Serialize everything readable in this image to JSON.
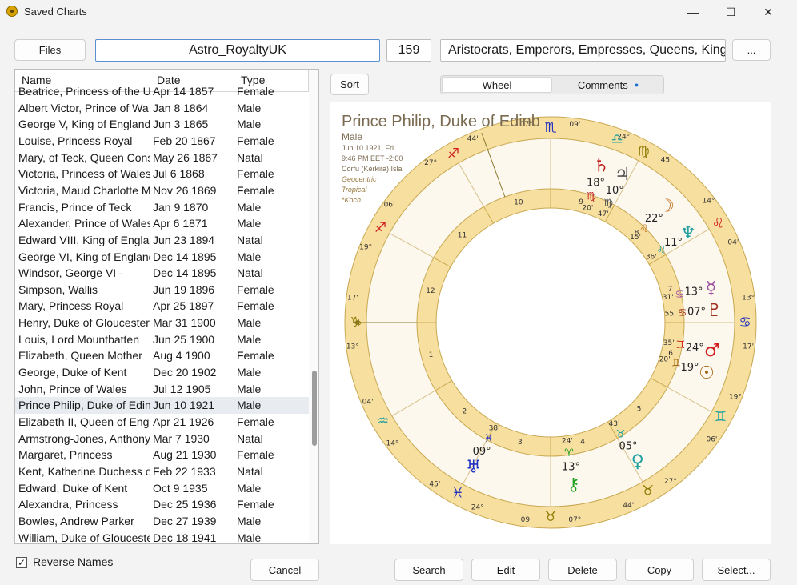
{
  "window": {
    "title": "Saved Charts",
    "minimize_glyph": "—",
    "maximize_glyph": "☐",
    "close_glyph": "✕"
  },
  "toolbar": {
    "files_label": "Files",
    "file_name": "Astro_RoyaltyUK",
    "count": "159",
    "description": "Aristocrats, Emperors, Empresses, Queens, Kings,",
    "more_label": "..."
  },
  "list": {
    "columns": [
      "Name",
      "Date",
      "Type"
    ],
    "rows": [
      [
        "Beatrice, Princess of the Ur",
        "Apr 14 1857",
        "Female"
      ],
      [
        "Albert Victor, Prince of Wa",
        "Jan 8 1864",
        "Male"
      ],
      [
        "George V, King of England",
        "Jun 3 1865",
        "Male"
      ],
      [
        "Louise, Princess Royal",
        "Feb 20 1867",
        "Female"
      ],
      [
        "Mary, of Teck, Queen Cons",
        "May 26 1867",
        "Natal"
      ],
      [
        "Victoria, Princess of Wales",
        "Jul 6 1868",
        "Female"
      ],
      [
        "Victoria, Maud Charlotte M",
        "Nov 26 1869",
        "Female"
      ],
      [
        "Francis, Prince of Teck",
        "Jan 9 1870",
        "Male"
      ],
      [
        "Alexander, Prince of Wales",
        "Apr 6 1871",
        "Male"
      ],
      [
        "Edward VIII, King of Englar",
        "Jun 23 1894",
        "Natal"
      ],
      [
        "George VI, King of England",
        "Dec 14 1895",
        "Male"
      ],
      [
        "Windsor, George VI -",
        "Dec 14 1895",
        "Natal"
      ],
      [
        "Simpson, Wallis",
        "Jun 19 1896",
        "Female"
      ],
      [
        "Mary, Princess Royal",
        "Apr 25 1897",
        "Female"
      ],
      [
        "Henry, Duke of Gloucester",
        "Mar 31 1900",
        "Male"
      ],
      [
        "Louis, Lord Mountbatten",
        "Jun 25 1900",
        "Male"
      ],
      [
        "Elizabeth, Queen Mother",
        "Aug 4 1900",
        "Female"
      ],
      [
        "George, Duke of Kent",
        "Dec 20 1902",
        "Male"
      ],
      [
        "John, Prince of Wales",
        "Jul 12 1905",
        "Male"
      ],
      [
        "Prince Philip, Duke of Edin",
        "Jun 10 1921",
        "Male"
      ],
      [
        "Elizabeth II, Queen of Engl",
        "Apr 21 1926",
        "Female"
      ],
      [
        "Armstrong-Jones, Anthony",
        "Mar 7 1930",
        "Natal"
      ],
      [
        "Margaret, Princess",
        "Aug 21 1930",
        "Female"
      ],
      [
        "Kent, Katherine Duchess o",
        "Feb 22 1933",
        "Natal"
      ],
      [
        "Edward, Duke of Kent",
        "Oct 9 1935",
        "Male"
      ],
      [
        "Alexandra, Princess",
        "Dec 25 1936",
        "Female"
      ],
      [
        "Bowles, Andrew Parker",
        "Dec 27 1939",
        "Male"
      ],
      [
        "William, Duke of Glouceste",
        "Dec 18 1941",
        "Male"
      ]
    ],
    "selected_index": 19
  },
  "sort_label": "Sort",
  "tabs": {
    "wheel": "Wheel",
    "comments": "Comments",
    "comments_dot": "●",
    "active": "Wheel"
  },
  "chart_info": {
    "name": "Prince Philip, Duke of Edinb",
    "gender": "Male",
    "date": "Jun 10 1921, Fri",
    "time": "9:46 PM EET -2:00",
    "place": "Corfu (Kérkira) Isla",
    "system": "Geocentric",
    "zodiac": "Tropical",
    "houses": "*Koch"
  },
  "wheel": {
    "house_numbers": [
      "1",
      "2",
      "3",
      "4",
      "5",
      "6",
      "7",
      "8",
      "9",
      "10",
      "11",
      "12"
    ],
    "cusp_degrees": [
      {
        "deg": "13°",
        "min": "17'",
        "sign": "♑",
        "color": "#8a7a00"
      },
      {
        "deg": "14°",
        "min": "04'",
        "sign": "♒",
        "color": "#20a0a0"
      },
      {
        "deg": "24°",
        "min": "45'",
        "sign": "♓",
        "color": "#2030c0"
      },
      {
        "deg": "07°",
        "min": "09'",
        "sign": "♉",
        "color": "#8a7a00"
      },
      {
        "deg": "27°",
        "min": "44'",
        "sign": "♉",
        "color": "#8a7a00"
      },
      {
        "deg": "19°",
        "min": "06'",
        "sign": "♊",
        "color": "#20a0a0"
      },
      {
        "deg": "13°",
        "min": "17'",
        "sign": "♋",
        "color": "#2030c0"
      },
      {
        "deg": "14°",
        "min": "04'",
        "sign": "♌",
        "color": "#d02020"
      },
      {
        "deg": "24°",
        "min": "45'",
        "sign": "♍",
        "color": "#8a7a00"
      },
      {
        "deg": "07°",
        "min": "09'",
        "sign": "♏",
        "color": "#2030c0"
      },
      {
        "deg": "27°",
        "min": "44'",
        "sign": "♐",
        "color": "#d02020"
      },
      {
        "deg": "19°",
        "min": "06'",
        "sign": "♐",
        "color": "#d02020"
      }
    ],
    "top_sign": "♎",
    "planets": [
      {
        "glyph": "♄",
        "deg": "18°",
        "sign": "♍",
        "min": "20'",
        "color": "#c02020"
      },
      {
        "glyph": "♃",
        "deg": "10°",
        "sign": "♍",
        "min": "47'",
        "color": "#555"
      },
      {
        "glyph": "☽",
        "deg": "22°",
        "sign": "♌",
        "min": "15'",
        "color": "#c07020"
      },
      {
        "glyph": "♆",
        "deg": "11°",
        "sign": "♌",
        "min": "36'",
        "color": "#20a0a0"
      },
      {
        "glyph": "☿",
        "deg": "13°",
        "sign": "♋",
        "min": "31'",
        "color": "#a050a0"
      },
      {
        "glyph": "♇",
        "deg": "07°",
        "sign": "♋",
        "min": "55'",
        "color": "#a03020"
      },
      {
        "glyph": "♂",
        "deg": "24°",
        "sign": "♊",
        "min": "35'",
        "color": "#d02020"
      },
      {
        "glyph": "☉",
        "deg": "19°",
        "sign": "♊",
        "min": "20'",
        "color": "#a06010"
      },
      {
        "glyph": "♀",
        "deg": "05°",
        "sign": "♉",
        "min": "43'",
        "color": "#20a0a0"
      },
      {
        "glyph": "⚷",
        "deg": "13°",
        "sign": "♈",
        "min": "24'",
        "color": "#20a020"
      },
      {
        "glyph": "♅",
        "deg": "09°",
        "sign": "♓",
        "min": "38'",
        "color": "#2030c0"
      }
    ]
  },
  "reverse_names": {
    "label": "Reverse Names",
    "checked": true,
    "check_glyph": "✓"
  },
  "buttons": {
    "cancel": "Cancel",
    "search": "Search",
    "edit": "Edit",
    "delete": "Delete",
    "copy": "Copy",
    "select": "Select..."
  },
  "colors": {
    "ring": "#f7dfa0",
    "ring_stroke": "#c8a850",
    "cream": "#fcf8ee",
    "accent": "#0a78d4"
  }
}
